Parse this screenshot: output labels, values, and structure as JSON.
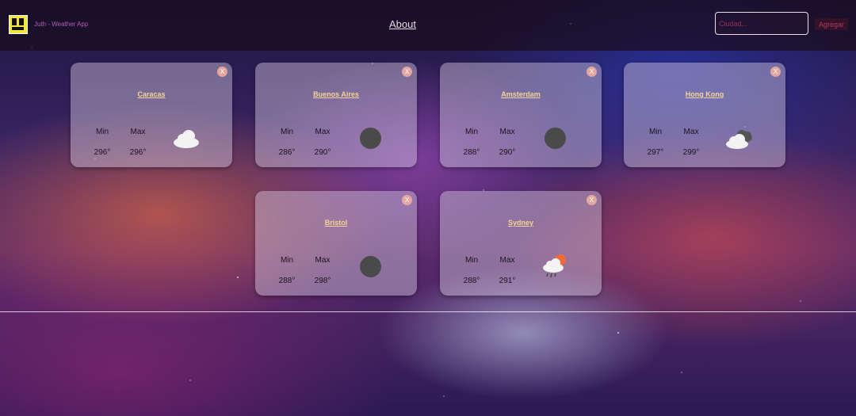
{
  "nav": {
    "brand": "Juth - Weather App",
    "about": "About",
    "search_placeholder": "Ciudad...",
    "add_button": "Agregar"
  },
  "cards": [
    {
      "city": "Caracas",
      "min_label": "Min",
      "max_label": "Max",
      "min": "296°",
      "max": "296°",
      "icon": "cloud-icon",
      "close": "X"
    },
    {
      "city": "Buenos Aires",
      "min_label": "Min",
      "max_label": "Max",
      "min": "286°",
      "max": "290°",
      "icon": "dark-circle-icon",
      "close": "X"
    },
    {
      "city": "Amsterdam",
      "min_label": "Min",
      "max_label": "Max",
      "min": "288°",
      "max": "290°",
      "icon": "dark-circle-icon",
      "close": "X"
    },
    {
      "city": "Hong Kong",
      "min_label": "Min",
      "max_label": "Max",
      "min": "297°",
      "max": "299°",
      "icon": "broken-clouds-icon",
      "close": "X"
    },
    {
      "city": "Bristol",
      "min_label": "Min",
      "max_label": "Max",
      "min": "288°",
      "max": "298°",
      "icon": "dark-circle-icon",
      "close": "X"
    },
    {
      "city": "Sydney",
      "min_label": "Min",
      "max_label": "Max",
      "min": "288°",
      "max": "291°",
      "icon": "sun-cloud-rain-icon",
      "close": "X"
    }
  ]
}
